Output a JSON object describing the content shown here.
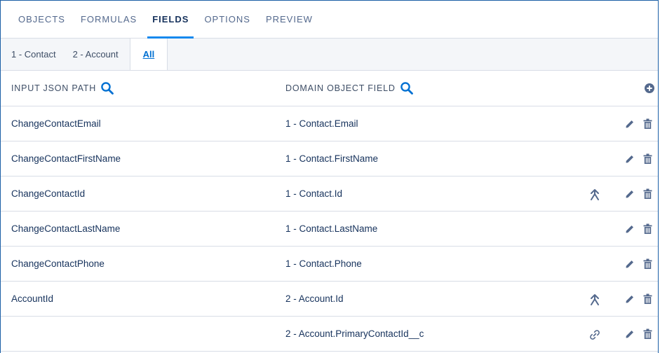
{
  "main_tabs": [
    {
      "label": "OBJECTS"
    },
    {
      "label": "FORMULAS"
    },
    {
      "label": "FIELDS"
    },
    {
      "label": "OPTIONS"
    },
    {
      "label": "PREVIEW"
    }
  ],
  "active_main_tab": "FIELDS",
  "sub_tabs": [
    {
      "label": "1 - Contact"
    },
    {
      "label": "2 - Account"
    },
    {
      "label": "All"
    }
  ],
  "active_sub_tab": "All",
  "columns": {
    "input": "INPUT JSON PATH",
    "domain": "DOMAIN OBJECT FIELD"
  },
  "icons": {
    "search": "search-icon",
    "add": "add-icon",
    "upsert_key": "upsert-key-icon",
    "link": "link-icon",
    "edit": "pencil-icon",
    "delete": "trash-icon"
  },
  "colors": {
    "accent": "#1589ee",
    "link": "#0070d2",
    "icon": "#54698d"
  },
  "rows": [
    {
      "input": "ChangeContactEmail",
      "domain": "1 - Contact.Email",
      "flag": ""
    },
    {
      "input": "ChangeContactFirstName",
      "domain": "1 - Contact.FirstName",
      "flag": ""
    },
    {
      "input": "ChangeContactId",
      "domain": "1 - Contact.Id",
      "flag": "upsert-key-icon"
    },
    {
      "input": "ChangeContactLastName",
      "domain": "1 - Contact.LastName",
      "flag": ""
    },
    {
      "input": "ChangeContactPhone",
      "domain": "1 - Contact.Phone",
      "flag": ""
    },
    {
      "input": "AccountId",
      "domain": "2 - Account.Id",
      "flag": "upsert-key-icon"
    },
    {
      "input": "",
      "domain": "2 - Account.PrimaryContactId__c",
      "flag": "link-icon"
    }
  ]
}
